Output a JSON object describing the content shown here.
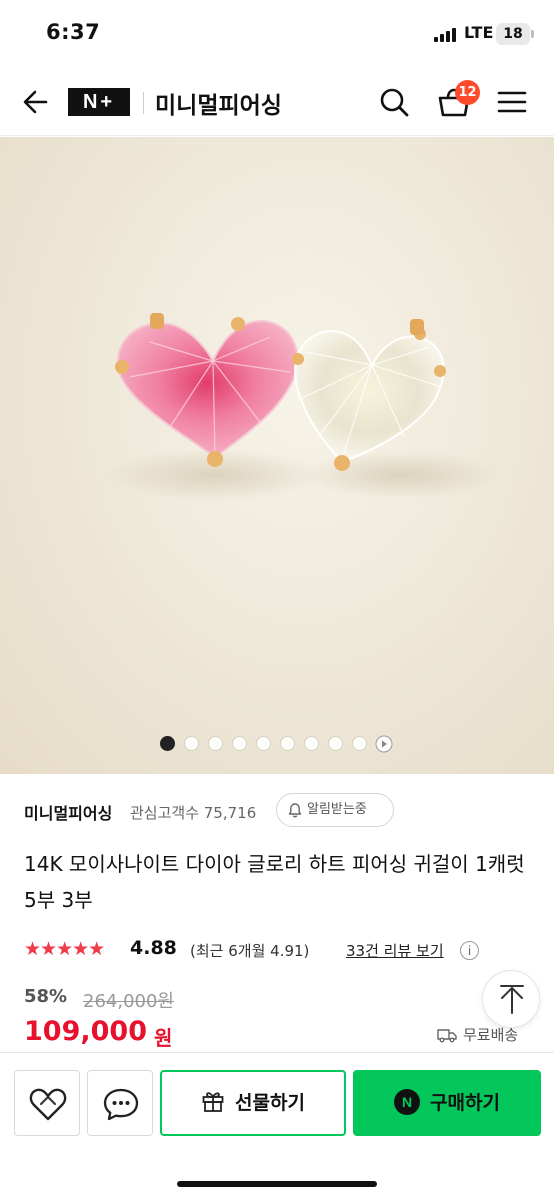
{
  "status_bar": {
    "time": "6:37",
    "network": "LTE",
    "battery": "18"
  },
  "header": {
    "logo": "N+",
    "store_name": "미니멀피어싱",
    "cart_count": "12"
  },
  "gallery": {
    "total_images": 9,
    "active_index": 0,
    "has_video": true
  },
  "seller": {
    "name": "미니멀피어싱",
    "followers": "관심고객수 75,716",
    "notify_label": "알림받는중"
  },
  "product": {
    "title": "14K 모이사나이트 다이아 글로리 하트 피어싱 귀걸이 1캐럿 5부 3부",
    "stars": "★★★★★",
    "rating": "4.88",
    "rating_recent": "(최근 6개월 4.91)",
    "review_link": "33건 리뷰 보기",
    "info_glyph": "i",
    "discount": "58%",
    "original_price": "264,000원",
    "price": "109,000",
    "price_unit": "원",
    "shipping": "무료배송"
  },
  "bottom_bar": {
    "gift_label": "선물하기",
    "npay_glyph": "N",
    "buy_label": "구매하기"
  },
  "colors": {
    "accent_green": "#03c75a",
    "price_red": "#e8112d",
    "badge_orange": "#ff4b2b",
    "star_red": "#f03a4a"
  }
}
